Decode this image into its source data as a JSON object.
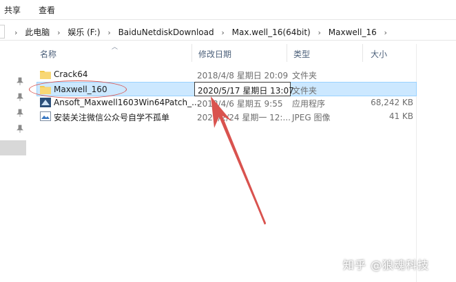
{
  "ribbon": {
    "tabs": [
      "共享",
      "查看"
    ]
  },
  "address": {
    "crumbs": [
      "此电脑",
      "娱乐 (F:)",
      "BaiduNetdiskDownload",
      "Max.well_16(64bit)",
      "Maxwell_16"
    ]
  },
  "columns": {
    "name": "名称",
    "date": "修改日期",
    "type": "类型",
    "size": "大小"
  },
  "files": [
    {
      "name": "Crack64",
      "date": "2018/4/8 星期日 20:09",
      "type": "文件夹",
      "size": "",
      "icon": "folder-icon"
    },
    {
      "name": "Maxwell_160",
      "date": "2020/5/17 星期日 13:07",
      "type": "文件夹",
      "size": "",
      "icon": "folder-icon",
      "selected": true
    },
    {
      "name": "Ansoft_Maxwell1603Win64Patch_...",
      "date": "2018/4/6 星期五 9:55",
      "type": "应用程序",
      "size": "68,242 KB",
      "icon": "app-icon"
    },
    {
      "name": "安装关注微信公众号自学不孤单",
      "date": "2020/2/24 星期一 12:...",
      "type": "JPEG 图像",
      "size": "41 KB",
      "icon": "image-icon"
    }
  ],
  "watermark": "知乎 @狼魂科技",
  "colors": {
    "selection": "#cce8ff",
    "annotation": "#d9534f",
    "folder": "#f2c94c"
  }
}
